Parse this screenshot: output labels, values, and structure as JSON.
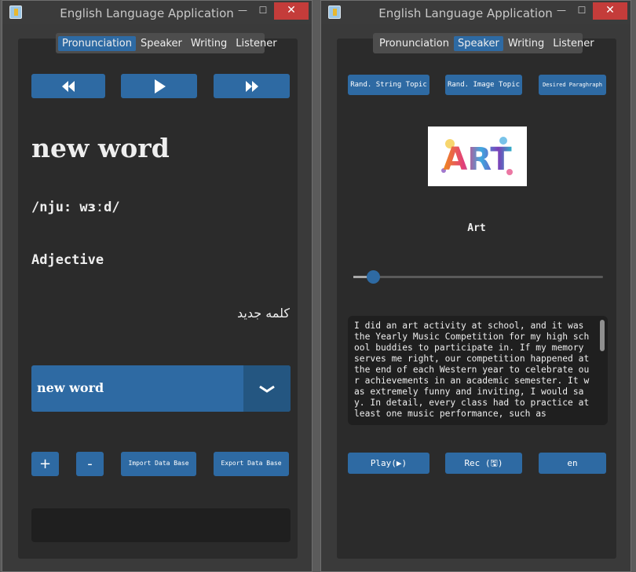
{
  "left_window": {
    "title": "English Language Application",
    "tabs": [
      {
        "label": "Pronunciation",
        "active": true
      },
      {
        "label": "Speaker",
        "active": false
      },
      {
        "label": "Writing",
        "active": false
      },
      {
        "label": "Listener",
        "active": false
      }
    ],
    "word": "new word",
    "phonetic": "/nju: wɜːd/",
    "part_of_speech": "Adjective",
    "translation": "کلمه جدید",
    "word_select": {
      "value": "new word"
    },
    "buttons": {
      "add": "+",
      "remove": "-",
      "import": "Import Data Base",
      "export": "Export Data Base"
    },
    "status_text": ""
  },
  "right_window": {
    "title": "English Language Application",
    "tabs": [
      {
        "label": "Pronunciation",
        "active": false
      },
      {
        "label": "Speaker",
        "active": true
      },
      {
        "label": "Writing",
        "active": false
      },
      {
        "label": "Listener",
        "active": false
      }
    ],
    "topic_buttons": {
      "string_topic": "Rand. String Topic",
      "image_topic": "Rand. Image Topic",
      "paragraph": "Desired Paraghraph"
    },
    "image_text": "ART",
    "topic_label": "Art",
    "slider_value": 0.08,
    "paragraph": "I did an art activity at school, and it was the Yearly Music Competition for my high school buddies to participate in. If my memory serves me right, our competition happened at the end of each Western year to celebrate our achievements in an academic semester. It was extremely funny and inviting, I would say. In detail, every class had to practice at least one music performance, such as",
    "buttons": {
      "play": "Play(▶)",
      "rec": "Rec (🖫)",
      "lang": "en"
    }
  },
  "colors": {
    "accent": "#2e6aa3",
    "close": "#c43c3a",
    "panel": "#2b2b2b",
    "window": "#3a3a3a"
  },
  "icons": [
    "app-icon",
    "rewind-icon",
    "play-icon",
    "fast-forward-icon",
    "chevron-down-icon",
    "minimize-icon",
    "maximize-icon",
    "close-icon"
  ]
}
